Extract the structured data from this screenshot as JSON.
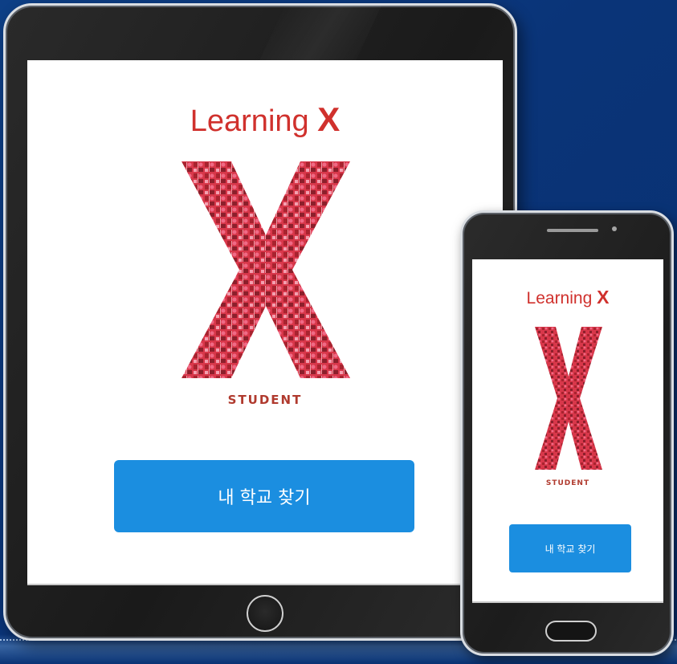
{
  "app": {
    "title_text": "Learning",
    "title_x": "X",
    "role": "STUDENT",
    "find_school_button": "내 학교 찾기"
  },
  "icons": {
    "logo": "mosaic-x-logo-icon",
    "tablet_home": "home-button-icon",
    "phone_home": "home-button-icon"
  },
  "colors": {
    "background": "#0a3478",
    "brand_red": "#d0312d",
    "button_blue": "#1b8ee0",
    "device_frame": "#1c1c1c"
  }
}
